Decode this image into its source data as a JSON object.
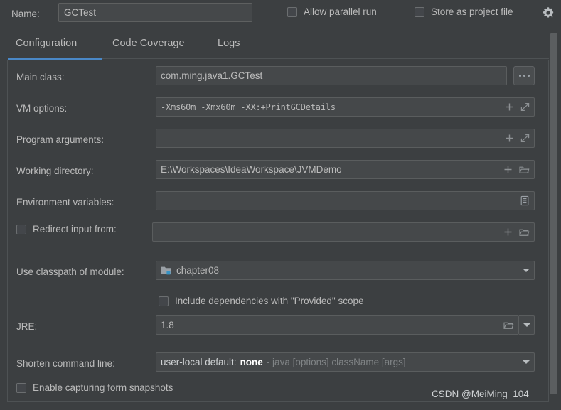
{
  "window": {
    "name_label": "Name:",
    "name_value": "GCTest",
    "allow_parallel_run": "Allow parallel run",
    "store_as_project_file": "Store as project file",
    "gear_icon": "gear-icon"
  },
  "tabs": [
    {
      "label": "Configuration",
      "active": true
    },
    {
      "label": "Code Coverage",
      "active": false
    },
    {
      "label": "Logs",
      "active": false
    }
  ],
  "form": {
    "main_class": {
      "label": "Main class:",
      "value": "com.ming.java1.GCTest",
      "browse_button": "browse-ellipsis-button"
    },
    "vm_options": {
      "label": "VM options:",
      "value": "-Xms60m -Xmx60m -XX:+PrintGCDetails",
      "icons": [
        "insert-macro-plus-icon",
        "expand-editor-icon"
      ]
    },
    "program_arguments": {
      "label": "Program arguments:",
      "value": "",
      "icons": [
        "insert-macro-plus-icon",
        "expand-editor-icon"
      ]
    },
    "working_directory": {
      "label": "Working directory:",
      "value": "E:\\Workspaces\\IdeaWorkspace\\JVMDemo",
      "icons": [
        "insert-macro-plus-icon",
        "folder-browse-icon"
      ]
    },
    "environment_variables": {
      "label": "Environment variables:",
      "value": "",
      "icons": [
        "environment-list-icon"
      ]
    },
    "redirect_input": {
      "label": "Redirect input from:",
      "checked": false,
      "value": "",
      "icons": [
        "insert-macro-plus-icon",
        "folder-browse-icon"
      ]
    },
    "classpath_module": {
      "label": "Use classpath of module:",
      "value": "chapter08",
      "module_icon": "module-folder-icon"
    },
    "include_provided": {
      "label": "Include dependencies with \"Provided\" scope",
      "checked": false
    },
    "jre": {
      "label": "JRE:",
      "value": "1.8",
      "icons": [
        "folder-browse-icon",
        "dropdown-caret-icon"
      ]
    },
    "shorten_command_line": {
      "label": "Shorten command line:",
      "value_primary": "user-local default:",
      "value_bold": "none",
      "value_hint": "- java [options] className [args]"
    },
    "enable_snapshots": {
      "label": "Enable capturing form snapshots",
      "checked": false
    }
  },
  "watermark": "CSDN @MeiMing_104",
  "colors": {
    "background": "#3c3f41",
    "field_background": "#45484a",
    "field_border": "#5a5d5e",
    "text": "#bbbbbb",
    "accent_tab": "#4a88c7",
    "module_badge": "#3592c4",
    "scrollbar_thumb": "#5b5e60"
  }
}
